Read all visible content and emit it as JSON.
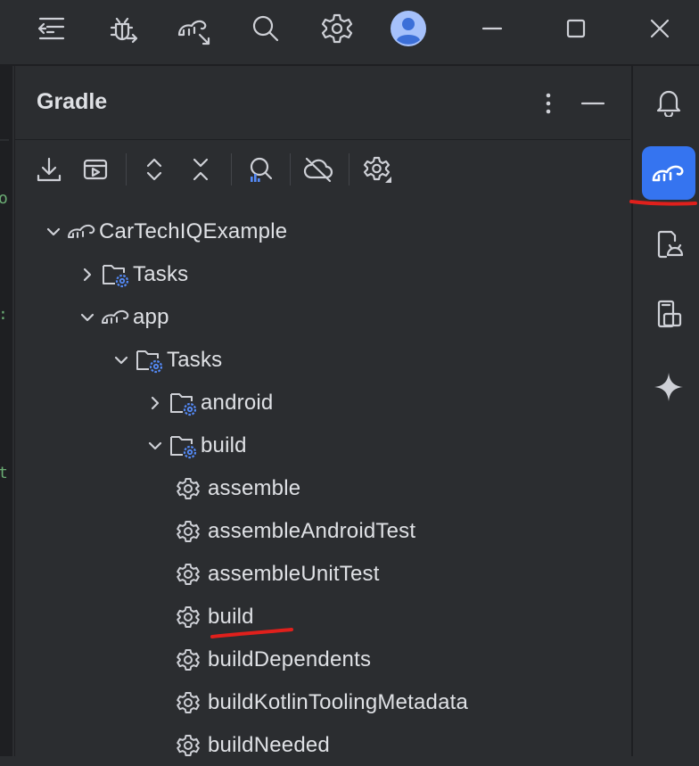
{
  "titlebar": {
    "icons": [
      "main-menu-icon",
      "debug-icon",
      "gradle-sync-icon",
      "search-icon",
      "settings-icon",
      "user-avatar",
      "minimize-icon",
      "maximize-icon",
      "close-icon"
    ]
  },
  "gradle_panel": {
    "title": "Gradle",
    "toolbar_icons": [
      "download-sources-icon",
      "run-task-icon",
      "expand-all-icon",
      "collapse-all-icon",
      "analyze-dependencies-icon",
      "offline-mode-icon",
      "build-tool-settings-icon"
    ],
    "tree": [
      {
        "label": "CarTechIQExample",
        "type": "project",
        "expanded": true
      },
      {
        "label": "Tasks",
        "type": "task-folder",
        "expanded": false
      },
      {
        "label": "app",
        "type": "module",
        "expanded": true
      },
      {
        "label": "Tasks",
        "type": "task-folder",
        "expanded": true
      },
      {
        "label": "android",
        "type": "task-folder",
        "expanded": false
      },
      {
        "label": "build",
        "type": "task-folder",
        "expanded": true
      },
      {
        "label": "assemble",
        "type": "task"
      },
      {
        "label": "assembleAndroidTest",
        "type": "task"
      },
      {
        "label": "assembleUnitTest",
        "type": "task"
      },
      {
        "label": "build",
        "type": "task",
        "highlighted": true
      },
      {
        "label": "buildDependents",
        "type": "task"
      },
      {
        "label": "buildKotlinToolingMetadata",
        "type": "task"
      },
      {
        "label": "buildNeeded",
        "type": "task"
      }
    ]
  },
  "right_strip": {
    "icons": [
      "notifications-icon",
      "gradle-tool-icon",
      "device-manager-icon",
      "running-devices-icon",
      "gemini-icon"
    ],
    "active": "gradle-tool-icon"
  },
  "colors": {
    "accent": "#3574f0",
    "annotation": "#e0201c",
    "text": "#dfe1e5",
    "icon": "#ced0d6",
    "gear_blue": "#548af7"
  }
}
